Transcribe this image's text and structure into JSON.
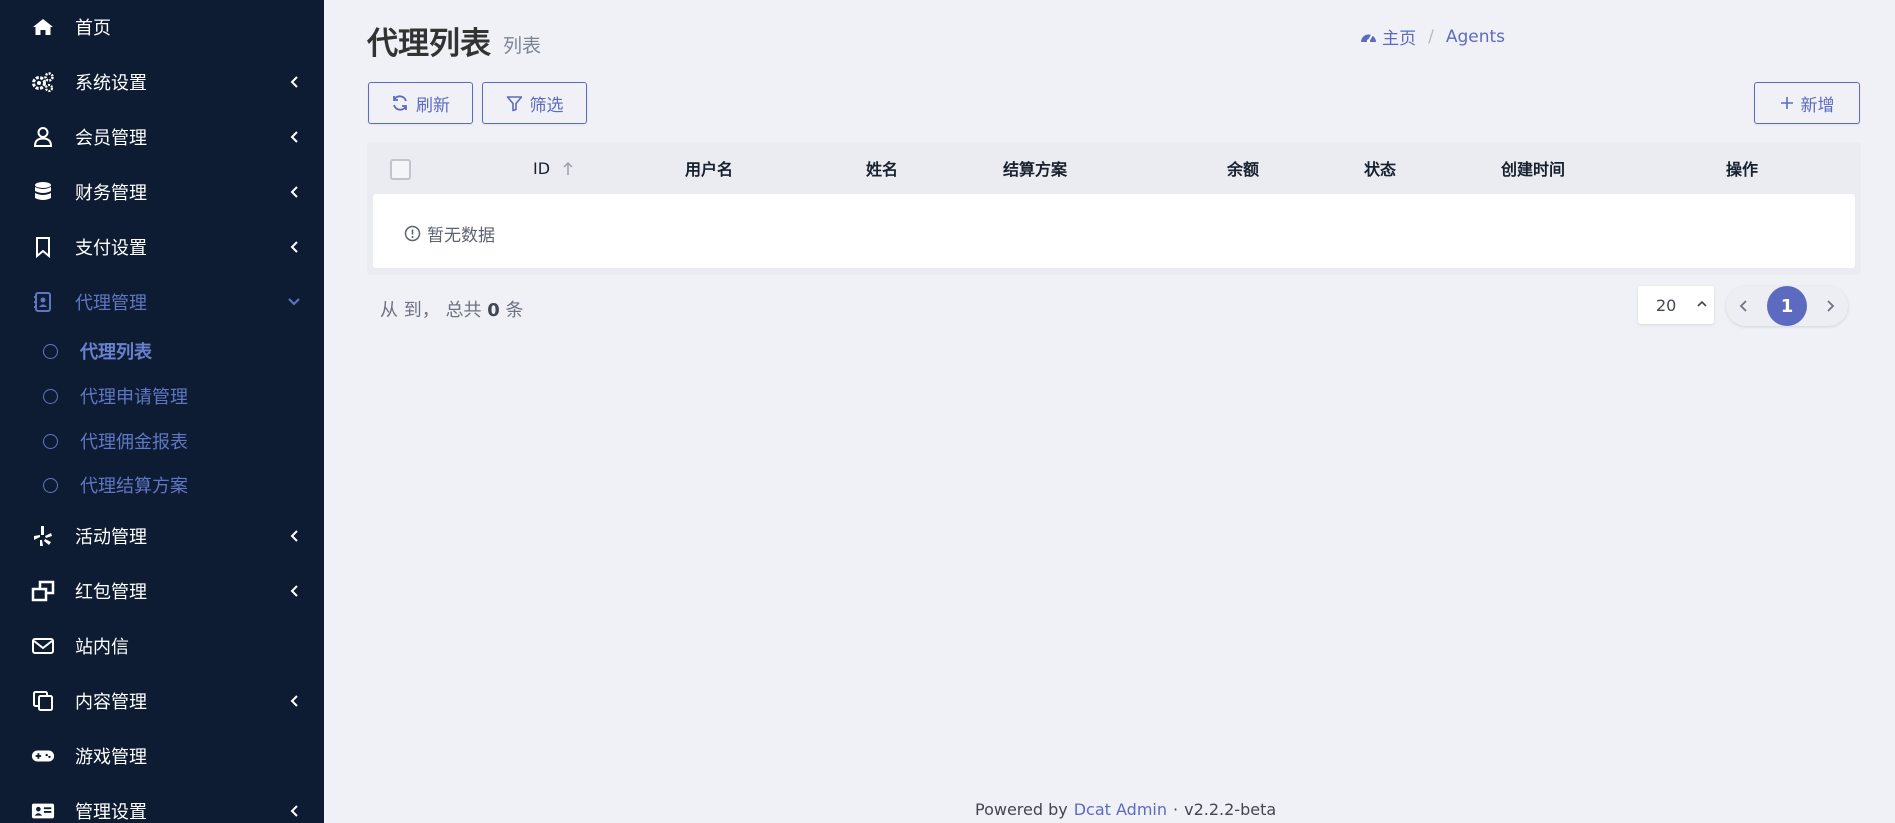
{
  "colors": {
    "sidebar_bg": "#0d1c33",
    "primary": "#5c6bc0",
    "page_bg": "#eff1f6"
  },
  "sidebar": {
    "items": [
      {
        "label": "首页",
        "icon": "home-icon"
      },
      {
        "label": "系统设置",
        "icon": "gears-icon"
      },
      {
        "label": "会员管理",
        "icon": "user-icon"
      },
      {
        "label": "财务管理",
        "icon": "database-icon"
      },
      {
        "label": "支付设置",
        "icon": "bookmark-icon"
      },
      {
        "label": "代理管理",
        "icon": "contact-book-icon"
      },
      {
        "label": "活动管理",
        "icon": "yelp-icon"
      },
      {
        "label": "红包管理",
        "icon": "windows-restore-icon"
      },
      {
        "label": "站内信",
        "icon": "envelope-icon"
      },
      {
        "label": "内容管理",
        "icon": "copy-icon"
      },
      {
        "label": "游戏管理",
        "icon": "gamepad-icon"
      },
      {
        "label": "管理设置",
        "icon": "id-card-icon"
      }
    ],
    "sub_items": [
      {
        "label": "代理列表"
      },
      {
        "label": "代理申请管理"
      },
      {
        "label": "代理佣金报表"
      },
      {
        "label": "代理结算方案"
      }
    ]
  },
  "header": {
    "title": "代理列表",
    "subtitle": "列表",
    "breadcrumb": {
      "home": "主页",
      "separator": "/",
      "current": "Agents"
    }
  },
  "toolbar": {
    "refresh_label": "刷新",
    "filter_label": "筛选",
    "new_label": "新增"
  },
  "table": {
    "columns": [
      "ID",
      "用户名",
      "姓名",
      "结算方案",
      "余额",
      "状态",
      "创建时间",
      "操作"
    ],
    "empty_text": "暂无数据"
  },
  "summary": {
    "prefix": "从 到， 总共",
    "total": "0",
    "suffix": "条"
  },
  "pagination": {
    "per_page": "20",
    "current_page": "1"
  },
  "footer": {
    "powered_by": "Powered by",
    "link": "Dcat Admin",
    "dot": "·",
    "version": "v2.2.2-beta"
  }
}
